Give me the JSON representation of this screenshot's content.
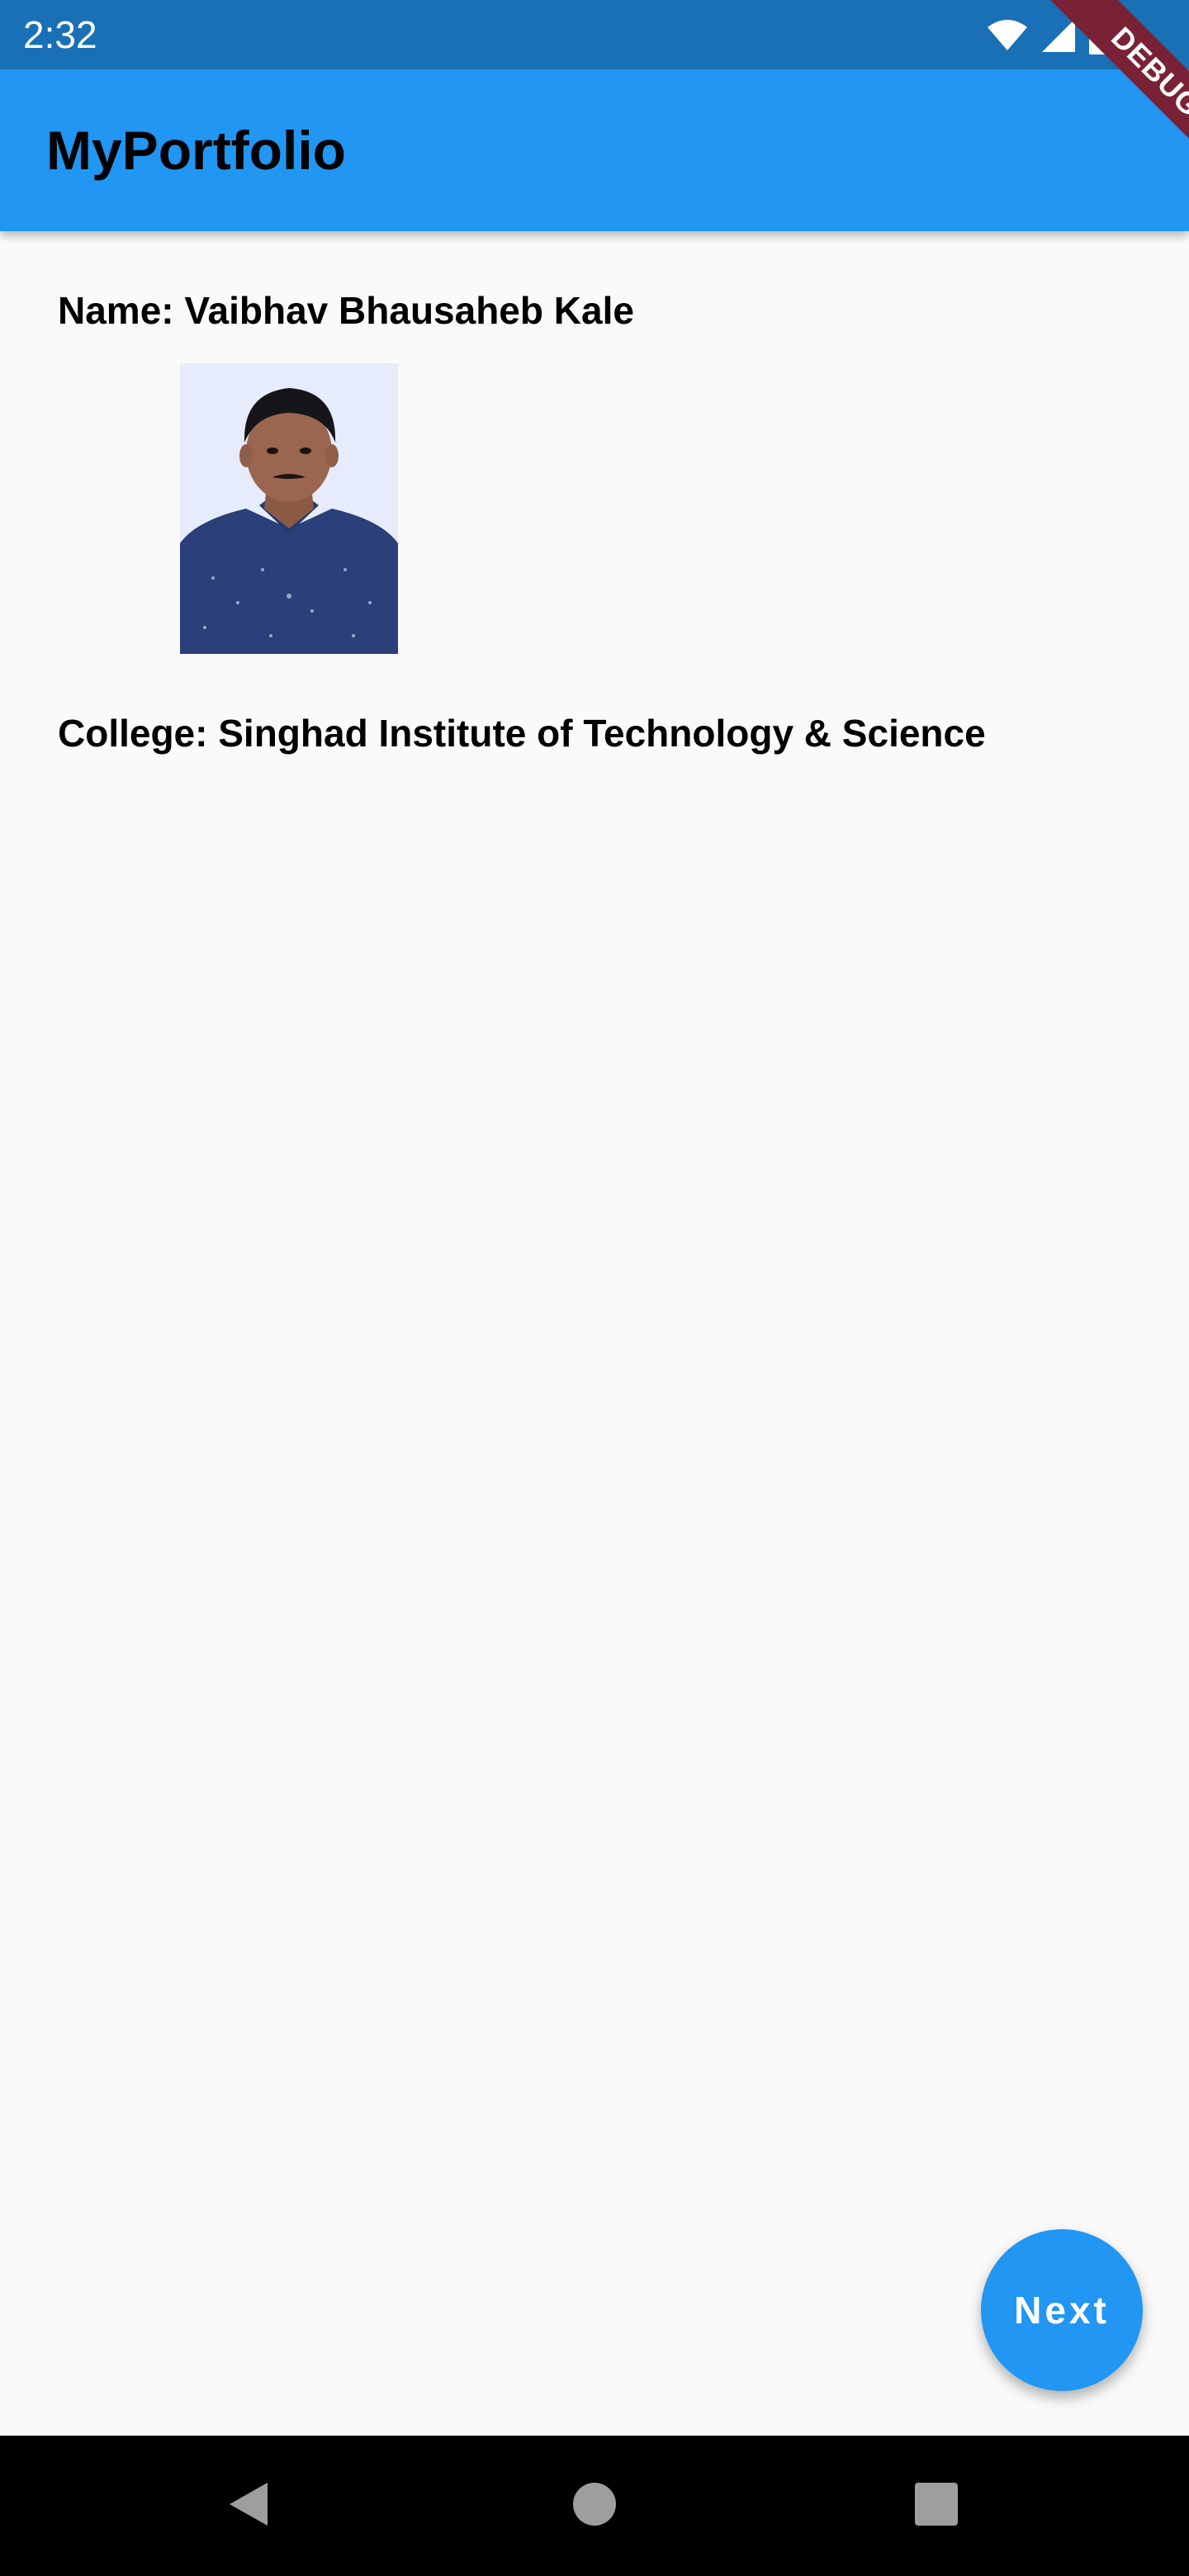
{
  "status_bar": {
    "time": "2:32",
    "icons": [
      "wifi-icon",
      "signal-icon",
      "battery-icon"
    ]
  },
  "debug_banner": {
    "label": "DEBUG"
  },
  "app_bar": {
    "title": "MyPortfolio",
    "color": "#2196f3"
  },
  "profile": {
    "name_line": "Name: Vaibhav Bhausaheb Kale",
    "college_line": "College: Singhad Institute of Technology & Science",
    "photo_alt": "profile-photo"
  },
  "fab": {
    "label": "Next",
    "color": "#2196f3"
  },
  "nav_bar": {
    "buttons": [
      "back-icon",
      "home-icon",
      "recents-icon"
    ]
  }
}
